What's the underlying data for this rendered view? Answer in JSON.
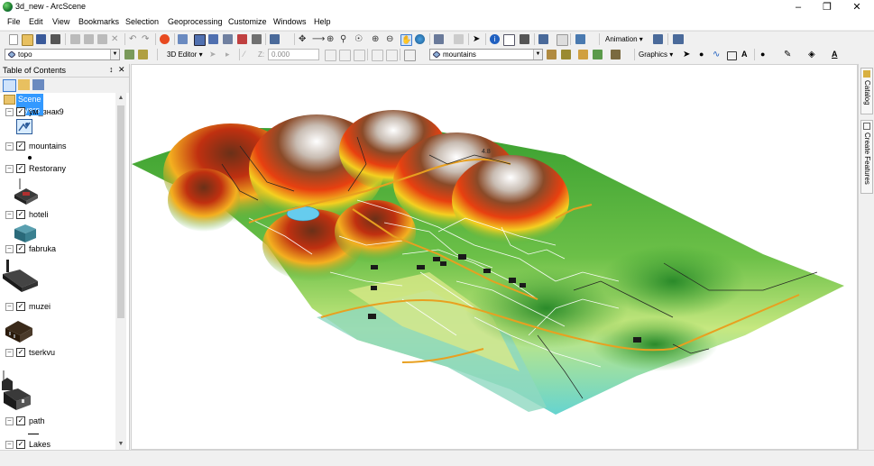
{
  "window": {
    "title": "3d_new - ArcScene"
  },
  "menu": [
    "File",
    "Edit",
    "View",
    "Bookmarks",
    "Selection",
    "Geoprocessing",
    "Customize",
    "Windows",
    "Help"
  ],
  "toolbar": {
    "animation_label": "Animation ▾",
    "layer_select": "topo",
    "editor_label": "3D Editor ▾",
    "z_label": "Z:",
    "z_value": "0.000",
    "target_layer": "mountains",
    "graphics_label": "Graphics ▾",
    "font_letter": "A"
  },
  "toc": {
    "title": "Table of Contents",
    "pin": "↕",
    "close": "✕",
    "root": "Scene layers",
    "layers": [
      {
        "name": "ум_знак9",
        "checked": true
      },
      {
        "name": "mountains",
        "checked": true
      },
      {
        "name": "Restorany",
        "checked": true
      },
      {
        "name": "hoteli",
        "checked": true
      },
      {
        "name": "fabruka",
        "checked": true
      },
      {
        "name": "muzei",
        "checked": true
      },
      {
        "name": "tserkvu",
        "checked": true
      },
      {
        "name": "path",
        "checked": true
      },
      {
        "name": "Lakes",
        "checked": true
      }
    ]
  },
  "side_tabs": [
    "Catalog",
    "Create Features"
  ],
  "scene_label": "4.8",
  "icons": {
    "app": "arcscene-globe-icon",
    "colors": {
      "selection": "#3399ff",
      "road": "#e8a020",
      "lake": "#66ccee"
    }
  }
}
